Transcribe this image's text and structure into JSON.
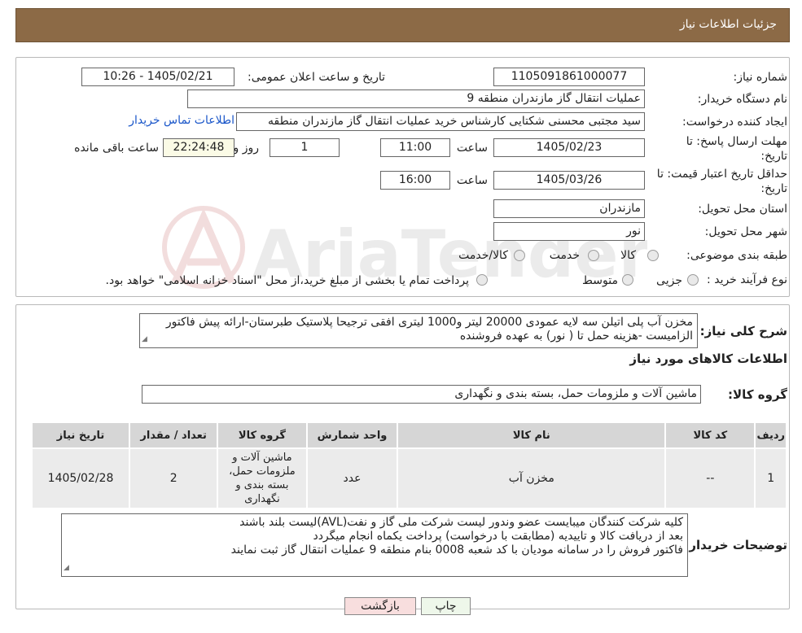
{
  "header": {
    "title": "جزئیات اطلاعات نیاز"
  },
  "watermark": {
    "text": "AriaTender.neT"
  },
  "form": {
    "need_number_label": "شماره نیاز:",
    "need_number": "1105091861000077",
    "announce_label": "تاریخ و ساعت اعلان عمومی:",
    "announce_value": "1405/02/21 - 10:26",
    "buyer_org_label": "نام دستگاه خریدار:",
    "buyer_org": "عملیات انتقال گاز مازندران منطقه 9",
    "creator_label": "ایجاد کننده درخواست:",
    "creator": "سید مجتبی محسنی شکتایی کارشناس خرید عملیات انتقال گاز مازندران منطقه",
    "contact_link": "اطلاعات تماس خریدار",
    "deadline_label_1": "مهلت ارسال پاسخ: تا",
    "deadline_label_2": "تاریخ:",
    "deadline_date": "1405/02/23",
    "time_label": "ساعت",
    "deadline_time": "11:00",
    "days_value": "1",
    "days_label": "روز و",
    "remaining_time": "22:24:48",
    "remaining_label": "ساعت باقی مانده",
    "validity_label_1": "حداقل تاریخ اعتبار قیمت: تا",
    "validity_label_2": "تاریخ:",
    "validity_date": "1405/03/26",
    "validity_time": "16:00",
    "province_label": "استان محل تحویل:",
    "province": "مازندران",
    "city_label": "شهر محل تحویل:",
    "city": "نور",
    "category_label": "طبقه بندی موضوعی:",
    "category_options": [
      "کالا",
      "خدمت",
      "کالا/خدمت"
    ],
    "purchase_type_label": "نوع فرآیند خرید :",
    "purchase_options": [
      "جزیی",
      "متوسط"
    ],
    "purchase_note": "پرداخت تمام یا بخشی از مبلغ خرید،از محل \"اسناد خزانه اسلامی\" خواهد بود."
  },
  "description": {
    "label": "شرح کلی نیاز:",
    "text": "مخزن آب پلی اتیلن سه لایه عمودی 20000 لیتر و1000 لیتری افقی ترجیحا پلاستیک طبرستان-ارائه پیش فاکتور الزامیست -هزینه حمل تا ( نور) به عهده فروشنده"
  },
  "goods": {
    "section_title": "اطلاعات کالاهای مورد نیاز",
    "group_label": "گروه کالا:",
    "group_value": "ماشین آلات و ملزومات حمل، بسته بندی و نگهداری",
    "columns": [
      "ردیف",
      "کد کالا",
      "نام کالا",
      "واحد شمارش",
      "گروه کالا",
      "تعداد / مقدار",
      "تاریخ نیاز"
    ],
    "rows": [
      [
        "1",
        "--",
        "مخزن آب",
        "عدد",
        "ماشین آلات و ملزومات حمل، بسته بندی و نگهداری",
        "2",
        "1405/02/28"
      ]
    ]
  },
  "buyer_notes": {
    "label": "توضیحات خریدار:",
    "lines": [
      "کلیه شرکت کنندگان میبایست عضو وندور لیست شرکت ملی گاز و نفت(AVL)لیست بلند باشند",
      "بعد از دریافت کالا و تاییدیه (مطابقت با درخواست) پرداخت یکماه انجام میگردد",
      "فاکتور فروش را در سامانه مودیان با کد شعبه 0008 بنام منطقه 9 عملیات انتقال گاز ثبت نمایند"
    ]
  },
  "buttons": {
    "print": "چاپ",
    "back": "بازگشت"
  },
  "colors": {
    "header": "#8c6a46",
    "link": "#1a56c9",
    "back_button": "#f8dede",
    "print_button": "#eef7ea"
  }
}
